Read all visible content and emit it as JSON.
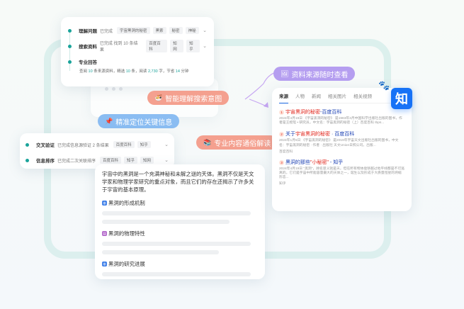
{
  "top_steps": {
    "step1": {
      "title": "理解问题",
      "status": "已完成",
      "chips": [
        "宇宙黑洞的秘密",
        "黑索",
        "秘密",
        "神秘"
      ]
    },
    "step2": {
      "title": "搜索资料",
      "status": "已完成 找到 10 条结果",
      "chips": [
        "百度百科",
        "知网",
        "知乎"
      ]
    },
    "step3": {
      "title": "专业回答",
      "query_prefix": "查阅",
      "sources_count": "10",
      "sources_label": "条来源资料，精选",
      "picked_count": "10",
      "picked_label": "条，阅读",
      "words_count": "2,730",
      "words_label": "字，节省",
      "minutes_count": "14",
      "minutes_label": "分钟"
    }
  },
  "pills": {
    "understand": "智能理解搜索意图",
    "sources": "资料来源随时查看",
    "locate": "精准定位关键信息",
    "interpret": "专业内容通俗解读"
  },
  "mid_steps": {
    "step1": {
      "title": "交叉验证",
      "status": "已完成信息源验证 2 条结果",
      "chips": [
        "百度百科",
        "知乎"
      ]
    },
    "step2": {
      "title": "信息排序",
      "status": "已完成二次关联排序",
      "chips": [
        "百度百科",
        "知乎",
        "知网"
      ]
    }
  },
  "article": {
    "intro": "宇宙中的黑洞是一个充满神秘和未解之谜的天体。黑洞不仅是天文学家和物理学家研究的重点对象，而且它们的存在还揭示了许多关于宇宙的基本原理。",
    "sections": [
      "黑洞的形成机制",
      "黑洞的物理特性",
      "黑洞的研究进展"
    ]
  },
  "results": {
    "tabs": [
      "来源",
      "人物",
      "新闻",
      "相关图片",
      "相关视频"
    ],
    "items": [
      {
        "badge": "1",
        "title_pre": "宇宙黑洞的秘密",
        "title_post": "-百度百科",
        "snippet": "2024年4月19日 《宇宙黑洞的秘密》 是1983年3月中国科学出版社出版的图书，作者是王绶琯 • 研究员。中文名：宇宙黑洞的秘密（上）百度百科 Ibps...",
        "source": "百度百科"
      },
      {
        "badge": "2",
        "title_pre": "关于",
        "title_red": "宇宙黑洞的秘密",
        "title_post": " · 百度百科",
        "snippet": "2024年1月5日 《宇宙黑洞的秘密》 是2019年宇宙天文出版社出版的图书，中文名：宇宙黑洞的秘密 · 作者 · 出版社 天文Union日照公司。出版...",
        "source": "百度百科"
      },
      {
        "badge": "3",
        "title_pre": "黑洞的那些",
        "title_red": "\"小秘密\"",
        "title_post": " - 知乎",
        "snippet": "2024年4月19日 \"黑洞\"，顾名思义就是天，但在所有物体能够越过地平线都是不可逃离的。它们是宇宙中所能容量最大的天体之一，诞生以及形成于大质量恒星的坍缩形态...",
        "source": "知乎"
      }
    ]
  },
  "brand": {
    "zhihu_logo": "知"
  },
  "colors": {
    "accent_teal": "#1aa39a",
    "pill_orange": "#f4a08f",
    "pill_purple": "#b59ef0",
    "pill_blue": "#8bbdf2",
    "zhihu_blue": "#1772f6",
    "link_blue": "#1a3fb3",
    "highlight_red": "#e1251b"
  },
  "icons": {
    "pill_understand": "bowl-icon",
    "pill_sources": "image-icon",
    "pill_locate": "pushpin-icon",
    "pill_interpret": "books-icon",
    "section1": "globe-icon",
    "section2": "book-icon",
    "section3": "globe-icon",
    "baidu": "paw-icon"
  }
}
